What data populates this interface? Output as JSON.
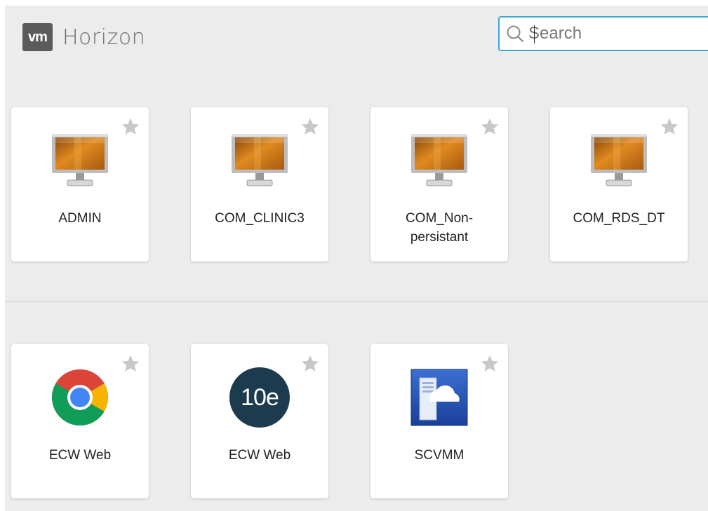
{
  "header": {
    "logo_text": "vm",
    "app_name": "Horizon",
    "search_placeholder": "Search"
  },
  "desktops": [
    {
      "label": "ADMIN",
      "icon": "desktop-monitor-icon"
    },
    {
      "label": "COM_CLINIC3",
      "icon": "desktop-monitor-icon"
    },
    {
      "label": "COM_Non-persistant",
      "icon": "desktop-monitor-icon"
    },
    {
      "label": "COM_RDS_DT",
      "icon": "desktop-monitor-icon"
    }
  ],
  "apps": [
    {
      "label": "ECW Web",
      "icon": "chrome-icon"
    },
    {
      "label": "ECW Web",
      "icon": "ecw-10e-icon",
      "icon_text": "10e"
    },
    {
      "label": "SCVMM",
      "icon": "scvmm-cloud-server-icon"
    }
  ],
  "colors": {
    "accent": "#3fa7d6",
    "background": "#ececec",
    "star": "#c8c8c8"
  }
}
